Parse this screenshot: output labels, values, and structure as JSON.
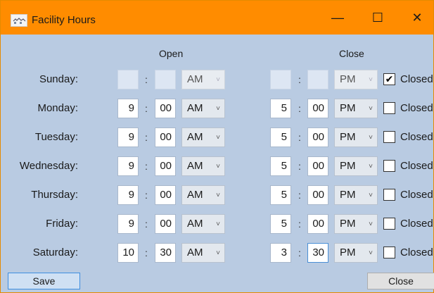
{
  "window": {
    "title": "Facility Hours",
    "icon": "facility-app-icon",
    "controls": {
      "minimize": "—",
      "maximize": "☐",
      "close": "✕"
    }
  },
  "headers": {
    "open": "Open",
    "close": "Close"
  },
  "separator": ":",
  "closed_label": "Closed",
  "days": [
    {
      "label": "Sunday:",
      "open_hour": "",
      "open_min": "",
      "open_ampm": "AM",
      "close_hour": "",
      "close_min": "",
      "close_ampm": "PM",
      "closed": true,
      "check": "✔"
    },
    {
      "label": "Monday:",
      "open_hour": "9",
      "open_min": "00",
      "open_ampm": "AM",
      "close_hour": "5",
      "close_min": "00",
      "close_ampm": "PM",
      "closed": false,
      "check": ""
    },
    {
      "label": "Tuesday:",
      "open_hour": "9",
      "open_min": "00",
      "open_ampm": "AM",
      "close_hour": "5",
      "close_min": "00",
      "close_ampm": "PM",
      "closed": false,
      "check": ""
    },
    {
      "label": "Wednesday:",
      "open_hour": "9",
      "open_min": "00",
      "open_ampm": "AM",
      "close_hour": "5",
      "close_min": "00",
      "close_ampm": "PM",
      "closed": false,
      "check": ""
    },
    {
      "label": "Thursday:",
      "open_hour": "9",
      "open_min": "00",
      "open_ampm": "AM",
      "close_hour": "5",
      "close_min": "00",
      "close_ampm": "PM",
      "closed": false,
      "check": ""
    },
    {
      "label": "Friday:",
      "open_hour": "9",
      "open_min": "00",
      "open_ampm": "AM",
      "close_hour": "5",
      "close_min": "00",
      "close_ampm": "PM",
      "closed": false,
      "check": ""
    },
    {
      "label": "Saturday:",
      "open_hour": "10",
      "open_min": "30",
      "open_ampm": "AM",
      "close_hour": "3",
      "close_min": "30",
      "close_ampm": "PM",
      "closed": false,
      "check": ""
    }
  ],
  "buttons": {
    "save": "Save",
    "close": "Close"
  },
  "colors": {
    "titlebar": "#ff8c00",
    "client": "#b9cbe2",
    "save_border": "#3d8ee0"
  }
}
